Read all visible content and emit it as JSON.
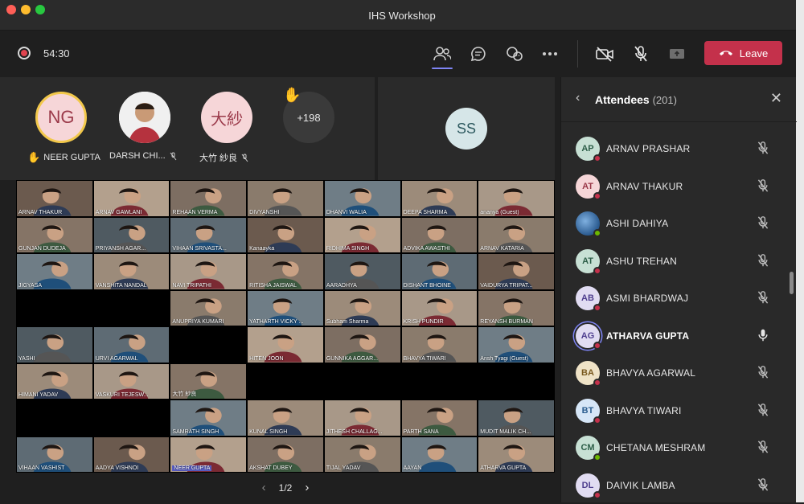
{
  "window": {
    "title": "IHS Workshop"
  },
  "toolbar": {
    "timer": "54:30",
    "leave_label": "Leave"
  },
  "stage": {
    "people": [
      {
        "initials": "NG",
        "name": "NEER GUPTA",
        "hand": true
      },
      {
        "initials": "",
        "name": "DARSH CHI...",
        "muted": true
      },
      {
        "initials": "大紗",
        "name": "大竹 紗良",
        "muted": true
      }
    ],
    "overflow": "+198",
    "spotlight_initials": "SS"
  },
  "grid_tiles": [
    "ARNAV THAKUR",
    "ARNAV GAWLANI",
    "REHAAN VERMA",
    "DIVYANSHI",
    "DHANVI WALIA",
    "DEEPA SHARMA",
    "ananya (Guest)",
    "GUNJAN DUDEJA",
    "PRIYANSH AGAR...",
    "VIHAAN SRIVASTA...",
    "Kanaayka",
    "RIDHIMA SINGH",
    "ADVIKA AWASTHI",
    "ARNAV KATARIA",
    "JIGYASA",
    "VANSHITA NANDAL",
    "NAVI TRIPATHI",
    "RITISHA JAISWAL",
    "AARADHYA",
    "DISHANT BHOINE",
    "VAIDURYA TRIPAT...",
    "",
    "",
    "ANUPRIYA KUMARI",
    "YATHARTH VICKY ...",
    "Subham Sharma",
    "KRISH PUNDIR",
    "REYANSH BURMAN",
    "YASHI",
    "URVI AGARWAL",
    "",
    "HITEN JOON",
    "GUNNIKA AGGAR...",
    "BHAVYA TIWARI",
    "Ansh Tyagi (Guest)",
    "HIMANI YADAV",
    "VASKURI TEJESW...",
    "大竹 紗良",
    "",
    "",
    "",
    "",
    "",
    "",
    "SAMRATH SINGH",
    "KUNAL SINGH",
    "JITHESH CHALLAG...",
    "PARTH SANA",
    "MUDIT MALIK CH...",
    "VIHAAN VASHIST",
    "AADYA VISHNOI",
    "NEER GUPTA",
    "AKSHAT DUBEY",
    "TIJAL YADAV",
    "AAYAN",
    "ATHARVA GUPTA"
  ],
  "pager": {
    "label": "1/2"
  },
  "panel": {
    "title": "Attendees",
    "count": "(201)",
    "attendees": [
      {
        "initials": "AP",
        "name": "ARNAV PRASHAR",
        "color": "#c7e0d4",
        "fg": "#2d5e48",
        "status": "#c4314b",
        "muted": true
      },
      {
        "initials": "AT",
        "name": "ARNAV THAKUR",
        "color": "#f6d6d8",
        "fg": "#9b3a4a",
        "status": "#c4314b",
        "muted": true
      },
      {
        "initials": "",
        "name": "ASHI DAHIYA",
        "color": "#3a6ea5",
        "fg": "#fff",
        "status": "#6bb700",
        "muted": true
      },
      {
        "initials": "AT",
        "name": "ASHU TREHAN",
        "color": "#c7e0d4",
        "fg": "#2d5e48",
        "status": "#c4314b",
        "muted": true
      },
      {
        "initials": "AB",
        "name": "ASMI BHARDWAJ",
        "color": "#e1dcf2",
        "fg": "#4f3f8f",
        "status": "#c4314b",
        "muted": true
      },
      {
        "initials": "AG",
        "name": "ATHARVA GUPTA",
        "color": "#e1dcf2",
        "fg": "#4f3f8f",
        "status": "#c4314b",
        "muted": false,
        "speaking": true
      },
      {
        "initials": "BA",
        "name": "BHAVYA AGARWAL",
        "color": "#efe3c7",
        "fg": "#7a5a1f",
        "status": "#c4314b",
        "muted": true
      },
      {
        "initials": "BT",
        "name": "BHAVYA TIWARI",
        "color": "#d6e6f7",
        "fg": "#2b5d8f",
        "status": "#c4314b",
        "muted": true
      },
      {
        "initials": "CM",
        "name": "CHETANA MESHRAM",
        "color": "#c7e0d4",
        "fg": "#2d5e48",
        "status": "#6bb700",
        "muted": true
      },
      {
        "initials": "DL",
        "name": "DAIVIK LAMBA",
        "color": "#e1dcf2",
        "fg": "#4f3f8f",
        "status": "#c4314b",
        "muted": true
      }
    ]
  }
}
